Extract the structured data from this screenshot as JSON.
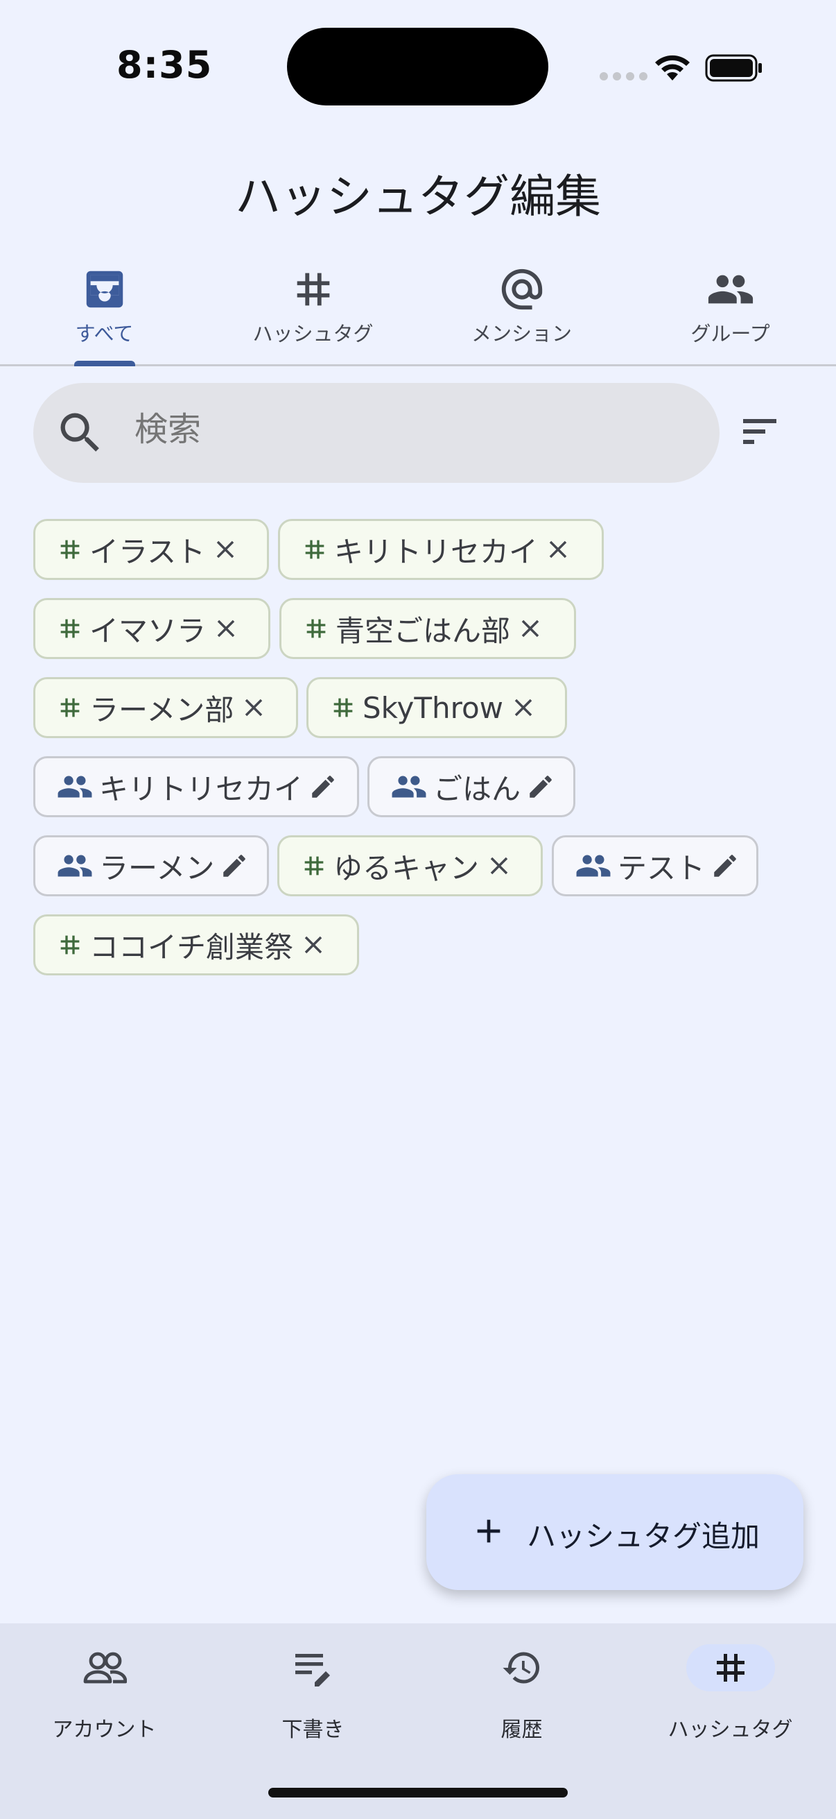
{
  "status_bar": {
    "time": "8:35"
  },
  "page_title": "ハッシュタグ編集",
  "tabs": [
    {
      "label": "すべて",
      "icon": "inbox-icon",
      "active": true
    },
    {
      "label": "ハッシュタグ",
      "icon": "hashtag-icon",
      "active": false
    },
    {
      "label": "メンション",
      "icon": "at-sign-icon",
      "active": false
    },
    {
      "label": "グループ",
      "icon": "group-icon",
      "active": false
    }
  ],
  "search": {
    "placeholder": "検索",
    "value": ""
  },
  "chips": [
    {
      "type": "hashtag",
      "label": "イラスト",
      "action": "remove"
    },
    {
      "type": "hashtag",
      "label": "キリトリセカイ",
      "action": "remove"
    },
    {
      "type": "hashtag",
      "label": "イマソラ",
      "action": "remove"
    },
    {
      "type": "hashtag",
      "label": "青空ごはん部",
      "action": "remove"
    },
    {
      "type": "hashtag",
      "label": "ラーメン部",
      "action": "remove"
    },
    {
      "type": "hashtag",
      "label": "SkyThrow",
      "action": "remove"
    },
    {
      "type": "group",
      "label": "キリトリセカイ",
      "action": "edit"
    },
    {
      "type": "group",
      "label": "ごはん",
      "action": "edit"
    },
    {
      "type": "group",
      "label": "ラーメン",
      "action": "edit"
    },
    {
      "type": "hashtag",
      "label": "ゆるキャン",
      "action": "remove"
    },
    {
      "type": "group",
      "label": "テスト",
      "action": "edit"
    },
    {
      "type": "hashtag",
      "label": "ココイチ創業祭",
      "action": "remove"
    }
  ],
  "fab": {
    "label": "ハッシュタグ追加",
    "icon": "plus-icon"
  },
  "bottom_nav": [
    {
      "label": "アカウント",
      "icon": "accounts-icon",
      "active": false
    },
    {
      "label": "下書き",
      "icon": "drafts-icon",
      "active": false
    },
    {
      "label": "履歴",
      "icon": "history-icon",
      "active": false
    },
    {
      "label": "ハッシュタグ",
      "icon": "hashtag-icon",
      "active": true
    }
  ],
  "colors": {
    "background": "#eef2fe",
    "accent": "#3d5c9b",
    "hashtag_icon": "#3f6a3c",
    "group_icon": "#3e5a8a",
    "fab_background": "#d9e2fd"
  }
}
